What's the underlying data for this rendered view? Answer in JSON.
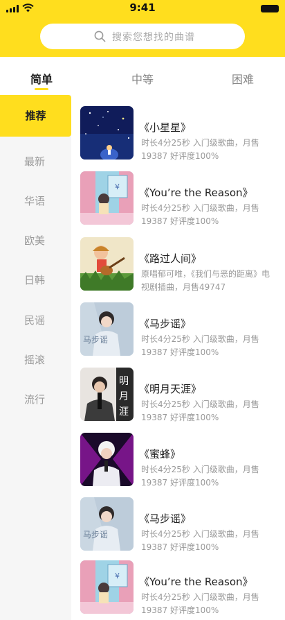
{
  "status_bar": {
    "time": "9:41"
  },
  "search": {
    "placeholder": "搜索您想找的曲谱"
  },
  "tabs": [
    {
      "label": "简单",
      "active": true
    },
    {
      "label": "中等",
      "active": false
    },
    {
      "label": "困难",
      "active": false
    }
  ],
  "sidebar": {
    "items": [
      "推荐",
      "最新",
      "华语",
      "欧美",
      "日韩",
      "民谣",
      "摇滚",
      "流行"
    ],
    "active": "推荐"
  },
  "songs": [
    {
      "title": "《小星星》",
      "desc": "时长4分25秒 入门级歌曲，月售19387 好评度100%",
      "cover": "starry-night-cover"
    },
    {
      "title": "《You’re the Reason》",
      "desc": "时长4分25秒 入门级歌曲，月售19387 好评度100%",
      "cover": "girl-window-cover"
    },
    {
      "title": "《路过人间》",
      "desc": "原唱郁可唯，《我们与恶的距离》电视剧插曲，月售49747",
      "cover": "girl-guitar-cover"
    },
    {
      "title": "《马步谣》",
      "desc": "时长4分25秒 入门级歌曲，月售19387 好评度100%",
      "cover": "girl-veil-cover"
    },
    {
      "title": "《明月天涯》",
      "desc": "时长4分25秒 入门级歌曲，月售19387 好评度100%",
      "cover": "singer-microphone-cover"
    },
    {
      "title": "《蜜蜂》",
      "desc": "时长4分25秒 入门级歌曲，月售19387 好评度100%",
      "cover": "singer-neon-cover"
    },
    {
      "title": "《马步谣》",
      "desc": "时长4分25秒 入门级歌曲，月售19387 好评度100%",
      "cover": "girl-veil-cover"
    },
    {
      "title": "《You’re the Reason》",
      "desc": "时长4分25秒 入门级歌曲，月售19387 好评度100%",
      "cover": "girl-window-cover"
    }
  ],
  "colors": {
    "accent": "#FFDE1E",
    "sidebar_bg": "#F6F6F6",
    "muted_text": "#999999"
  }
}
